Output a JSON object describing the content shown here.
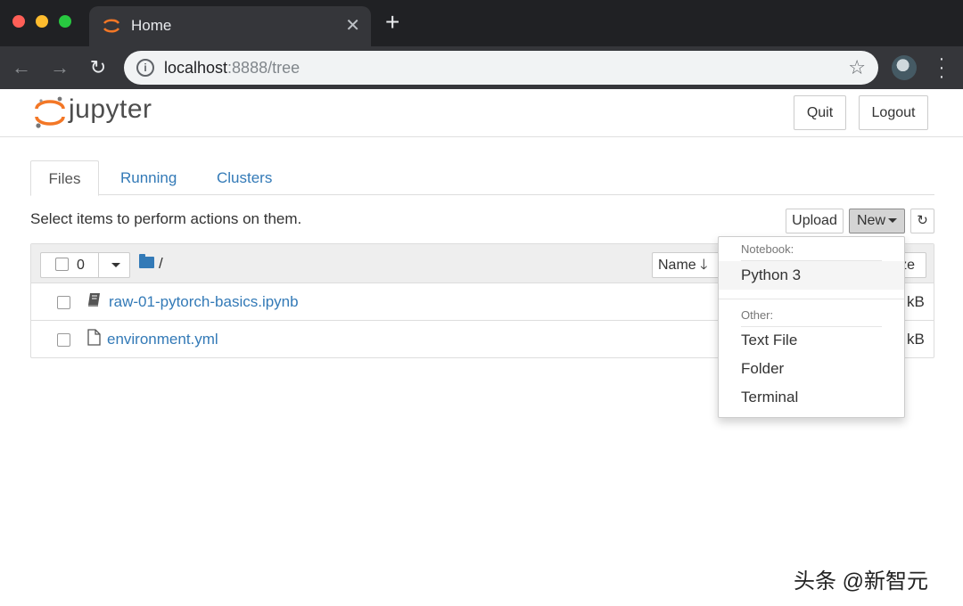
{
  "browser": {
    "tab_title": "Home",
    "url_host": "localhost",
    "url_rest": ":8888/tree"
  },
  "header": {
    "wordmark": "jupyter",
    "quit_label": "Quit",
    "logout_label": "Logout"
  },
  "tabs": [
    {
      "label": "Files"
    },
    {
      "label": "Running"
    },
    {
      "label": "Clusters"
    }
  ],
  "toolbar": {
    "hint": "Select items to perform actions on them.",
    "upload_label": "Upload",
    "new_label": "New",
    "refresh_icon": "↻"
  },
  "list": {
    "selected_count": "0",
    "breadcrumb": "/",
    "sort_label": "Name",
    "size_col_label": "ze",
    "rows": [
      {
        "name": "raw-01-pytorch-basics.ipynb",
        "size": "kB",
        "icon": "notebook-icon"
      },
      {
        "name": "environment.yml",
        "size": "kB",
        "icon": "file-icon"
      }
    ]
  },
  "new_menu": {
    "notebook_header": "Notebook:",
    "python_item": "Python 3",
    "other_header": "Other:",
    "items": [
      "Text File",
      "Folder",
      "Terminal"
    ]
  },
  "watermark": "头条 @新智元",
  "colors": {
    "link": "#337ab7",
    "jupyter_orange": "#f37726",
    "chrome_dark": "#202124"
  }
}
